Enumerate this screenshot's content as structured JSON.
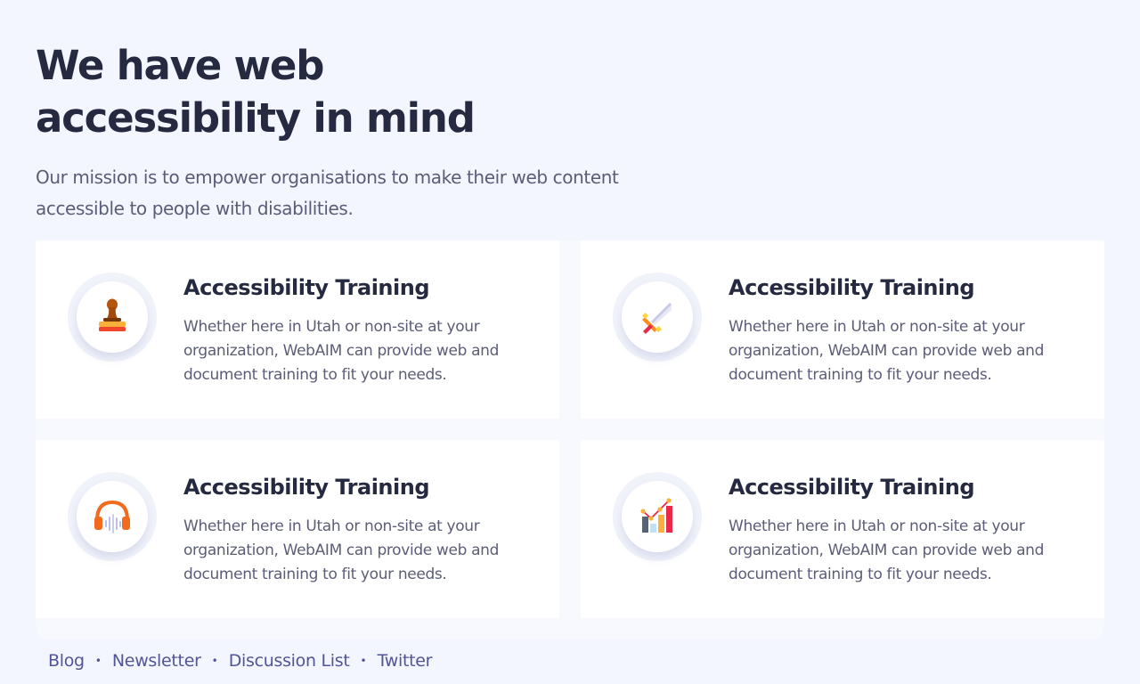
{
  "hero": {
    "title": "We have web accessibility in mind",
    "text": "Our mission is to empower organisations to make their web content accessible to people with disabilities."
  },
  "cards": [
    {
      "title": "Accessibility Training",
      "text": "Whether here in Utah or non-site at your organization, WebAIM can provide web and document training to fit your needs.",
      "icon": "stamp-icon"
    },
    {
      "title": "Accessibility Training",
      "text": "Whether here in Utah or non-site at your organization, WebAIM can provide web and document training to fit your needs.",
      "icon": "sword-icon"
    },
    {
      "title": "Accessibility Training",
      "text": "Whether here in Utah or non-site at your organization, WebAIM can provide web and document training to fit your needs.",
      "icon": "headphones-icon"
    },
    {
      "title": "Accessibility Training",
      "text": "Whether here in Utah or non-site at your organization, WebAIM can provide web and document training to fit your needs.",
      "icon": "bar-chart-icon"
    }
  ],
  "footer": {
    "links": [
      "Blog",
      "Newsletter",
      "Discussion List",
      "Twitter"
    ],
    "separator": "•"
  },
  "colors": {
    "background": "#f3f6fe",
    "heading": "#262a41",
    "body_text": "#5b5d78",
    "link": "#515596",
    "card": "#ffffff"
  }
}
